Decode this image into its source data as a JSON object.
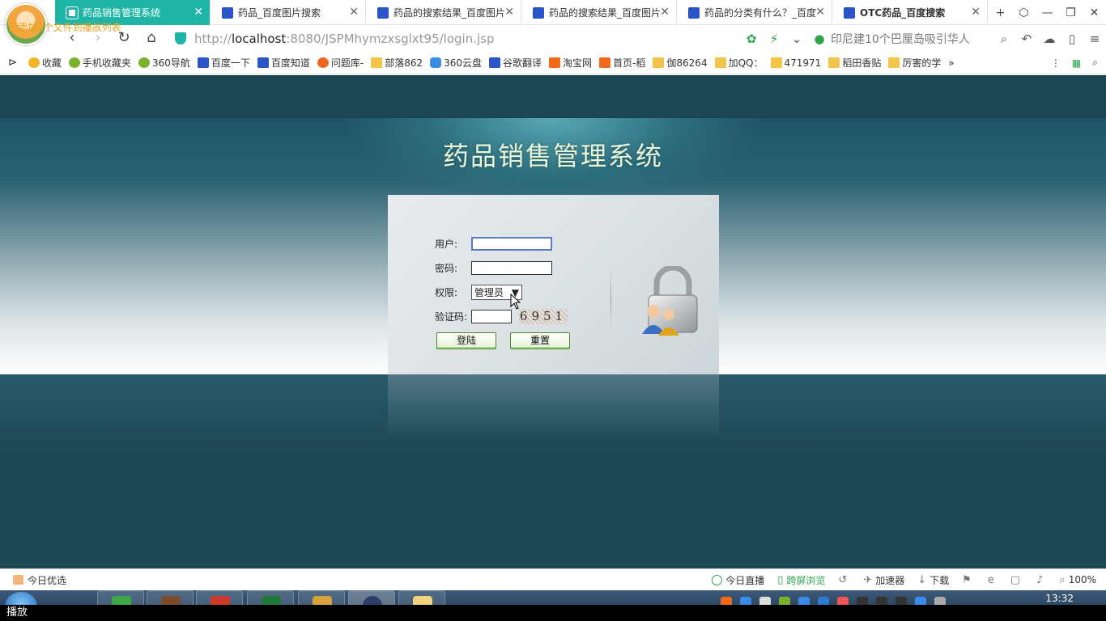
{
  "browser": {
    "avatar_note": "已添加1个文件到播放列表",
    "tabs": [
      {
        "title": "药品销售管理系统",
        "active": true
      },
      {
        "title": "药品_百度图片搜索"
      },
      {
        "title": "药品的搜索结果_百度图片"
      },
      {
        "title": "药品的搜索结果_百度图片"
      },
      {
        "title": "药品的分类有什么？_百度"
      },
      {
        "title": "OTC药品_百度搜索",
        "bold": true
      }
    ],
    "new_tab": "+",
    "address": {
      "scheme": "http://",
      "host": "localhost",
      "rest": ":8080/JSPMhymzxsglxt95/login.jsp",
      "search_hint": "印尼建10个巴厘岛吸引华人"
    },
    "bookmarks": [
      {
        "label": "收藏",
        "icon": "star"
      },
      {
        "label": "手机收藏夹",
        "icon": "green"
      },
      {
        "label": "360导航",
        "icon": "green"
      },
      {
        "label": "百度一下",
        "icon": "paw"
      },
      {
        "label": "百度知道",
        "icon": "paw"
      },
      {
        "label": "问题库-",
        "icon": "orange"
      },
      {
        "label": "部落862",
        "icon": "folder"
      },
      {
        "label": "360云盘",
        "icon": "cloud"
      },
      {
        "label": "谷歌翻译",
        "icon": "paw"
      },
      {
        "label": "淘宝网",
        "icon": "taobao"
      },
      {
        "label": "首页-稻",
        "icon": "taobao"
      },
      {
        "label": "伽86264",
        "icon": "folder"
      },
      {
        "label": "加QQ：",
        "icon": "folder"
      },
      {
        "label": "471971",
        "icon": "folder"
      },
      {
        "label": "稻田香贴",
        "icon": "folder"
      },
      {
        "label": "厉害的学",
        "icon": "folder"
      }
    ]
  },
  "login": {
    "title": "药品销售管理系统",
    "user_label": "用户:",
    "pass_label": "密码:",
    "role_label": "权限:",
    "role_value": "管理员",
    "captcha_label": "验证码:",
    "captcha_value": "6951",
    "login_btn": "登陆",
    "reset_btn": "重置"
  },
  "status": {
    "today": "今日优选",
    "live": "今日直播",
    "cross": "跨屏浏览",
    "accel": "加速器",
    "download": "下载",
    "zoom": "100%"
  },
  "taskbar": {
    "clock": "13:32",
    "tip": "播放"
  },
  "colors": {
    "tab_active": "#1fb5a6",
    "page_bg": "#1d4856",
    "title_text": "#e9f6d8",
    "button_border": "#4a8a2a"
  }
}
